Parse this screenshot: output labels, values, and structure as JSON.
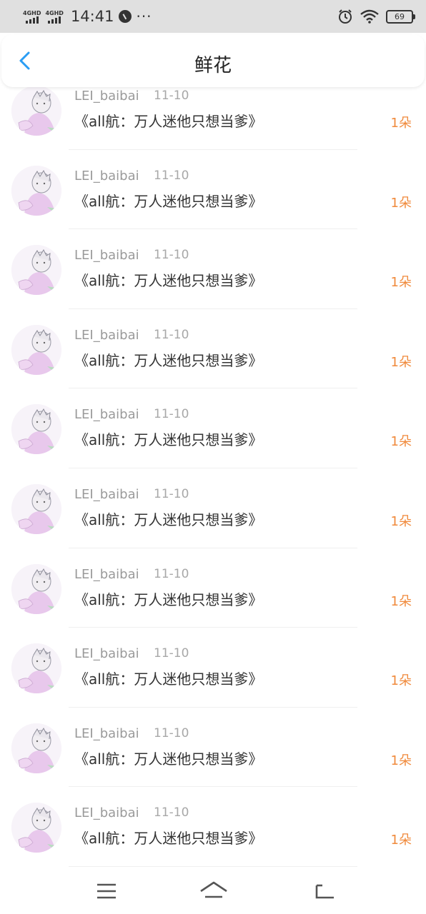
{
  "status": {
    "sim1": "4GHD",
    "sim2": "4GHD",
    "time": "14:41",
    "more": "···",
    "battery": "69"
  },
  "header": {
    "title": "鲜花"
  },
  "items": [
    {
      "user": "LEI_baibai",
      "date": "11-10",
      "book": "《all航：万人迷他只想当爹》",
      "count": "1朵"
    },
    {
      "user": "LEI_baibai",
      "date": "11-10",
      "book": "《all航：万人迷他只想当爹》",
      "count": "1朵"
    },
    {
      "user": "LEI_baibai",
      "date": "11-10",
      "book": "《all航：万人迷他只想当爹》",
      "count": "1朵"
    },
    {
      "user": "LEI_baibai",
      "date": "11-10",
      "book": "《all航：万人迷他只想当爹》",
      "count": "1朵"
    },
    {
      "user": "LEI_baibai",
      "date": "11-10",
      "book": "《all航：万人迷他只想当爹》",
      "count": "1朵"
    },
    {
      "user": "LEI_baibai",
      "date": "11-10",
      "book": "《all航：万人迷他只想当爹》",
      "count": "1朵"
    },
    {
      "user": "LEI_baibai",
      "date": "11-10",
      "book": "《all航：万人迷他只想当爹》",
      "count": "1朵"
    },
    {
      "user": "LEI_baibai",
      "date": "11-10",
      "book": "《all航：万人迷他只想当爹》",
      "count": "1朵"
    },
    {
      "user": "LEI_baibai",
      "date": "11-10",
      "book": "《all航：万人迷他只想当爹》",
      "count": "1朵"
    },
    {
      "user": "LEI_baibai",
      "date": "11-10",
      "book": "《all航：万人迷他只想当爹》",
      "count": "1朵"
    }
  ],
  "colors": {
    "accent_back": "#2a9df4",
    "count": "#f08a3c",
    "statusbar_bg": "#e0e0e0"
  },
  "icons": {
    "back": "chevron-left-icon",
    "menu": "menu-icon",
    "home": "home-icon",
    "return": "return-icon",
    "alarm": "alarm-icon",
    "wifi": "wifi-icon"
  }
}
